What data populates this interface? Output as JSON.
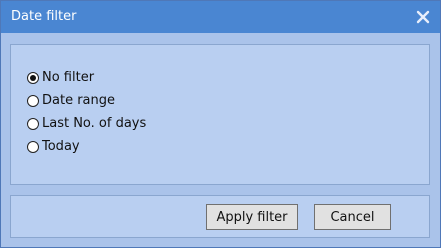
{
  "dialog": {
    "title": "Date filter",
    "close_icon": "close-icon"
  },
  "options": [
    {
      "label": "No filter",
      "checked": true
    },
    {
      "label": "Date range",
      "checked": false
    },
    {
      "label": "Last No. of days",
      "checked": false
    },
    {
      "label": "Today",
      "checked": false
    }
  ],
  "buttons": {
    "apply_label": "Apply filter",
    "cancel_label": "Cancel"
  },
  "colors": {
    "titlebar": "#4a86d2",
    "dialog_bg": "#aac3ea",
    "panel_bg": "#b9cff1"
  }
}
